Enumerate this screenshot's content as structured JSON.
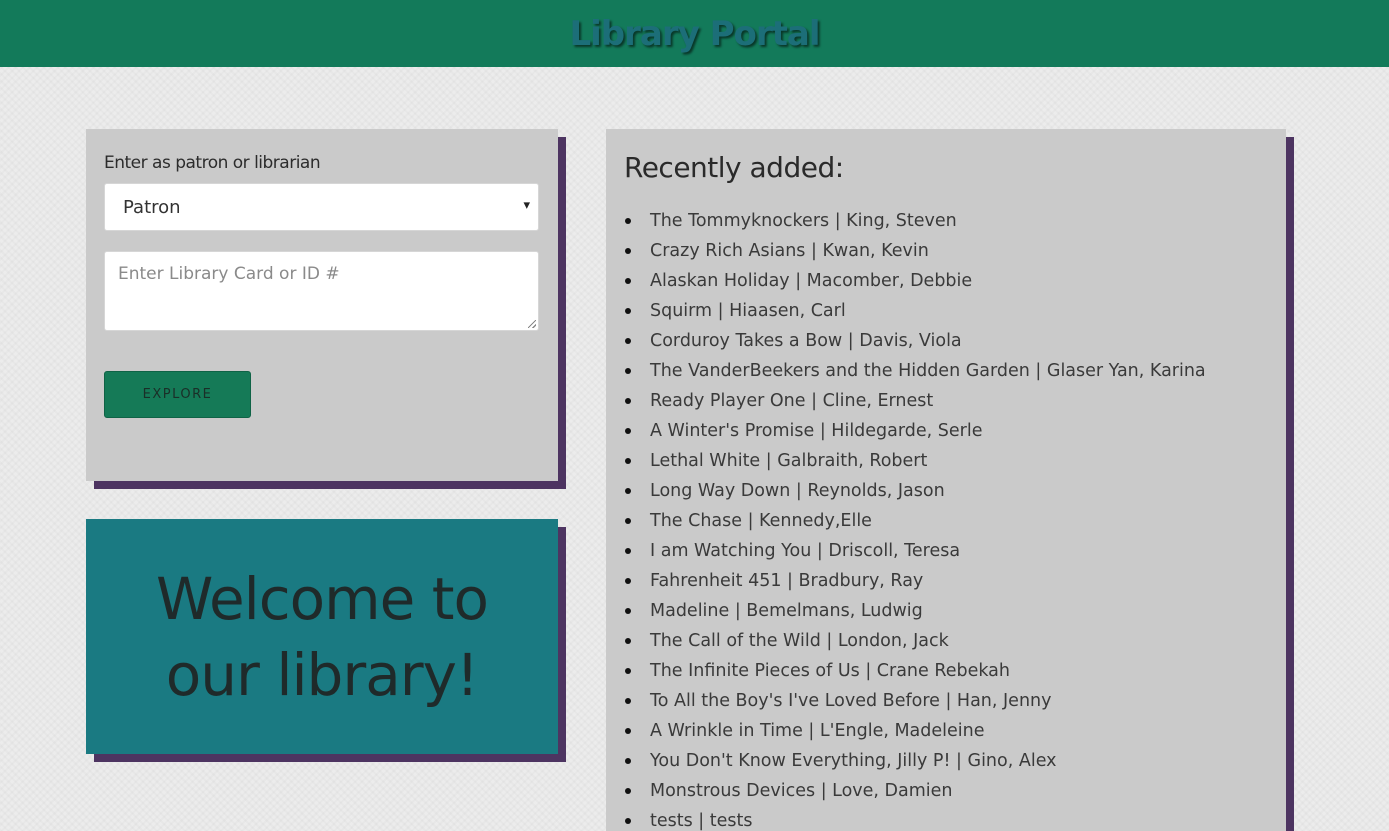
{
  "header": {
    "title": "Library Portal"
  },
  "login": {
    "label": "Enter as patron or librarian",
    "select_value": "Patron",
    "select_arrow": "▾",
    "id_placeholder": "Enter Library Card or ID #",
    "button_label": "EXPLORE"
  },
  "welcome": {
    "text": "Welcome to our library!"
  },
  "recent": {
    "heading": "Recently added:",
    "books": [
      "The Tommyknockers | King, Steven",
      "Crazy Rich Asians | Kwan, Kevin",
      "Alaskan Holiday | Macomber, Debbie",
      "Squirm | Hiaasen, Carl",
      "Corduroy Takes a Bow | Davis, Viola",
      "The VanderBeekers and the Hidden Garden | Glaser Yan, Karina",
      "Ready Player One | Cline, Ernest",
      "A Winter's Promise | Hildegarde, Serle",
      "Lethal White | Galbraith, Robert",
      "Long Way Down | Reynolds, Jason",
      "The Chase | Kennedy,Elle",
      "I am Watching You | Driscoll, Teresa",
      "Fahrenheit 451 | Bradbury, Ray",
      "Madeline | Bemelmans, Ludwig",
      "The Call of the Wild | London, Jack",
      "The Infinite Pieces of Us | Crane Rebekah",
      "To All the Boy's I've Loved Before | Han, Jenny",
      "A Wrinkle in Time | L'Engle, Madeleine",
      "You Don't Know Everything, Jilly P! | Gino, Alex",
      "Monstrous Devices | Love, Damien",
      "tests | tests"
    ]
  },
  "colors": {
    "header_bg": "#137a5a",
    "title_text": "#1c6e78",
    "panel_bg": "#cacaca",
    "panel_shadow": "#4d3461",
    "welcome_bg": "#1a7a82",
    "button_bg": "#157a57"
  }
}
